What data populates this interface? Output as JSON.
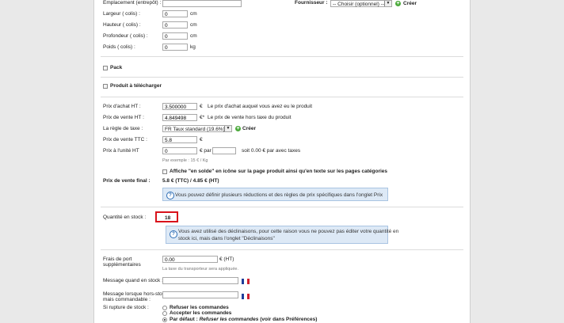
{
  "top": {
    "emplacement_label": "Emplacement (entrepôt) :",
    "largeur_label": "Largeur ( colis) :",
    "largeur_value": "0",
    "hauteur_label": "Hauteur ( colis) :",
    "hauteur_value": "0",
    "profondeur_label": "Profondeur ( colis) :",
    "profondeur_value": "0",
    "poids_label": "Poids ( colis) :",
    "poids_value": "0",
    "unit_cm": "cm",
    "unit_kg": "kg",
    "fournisseur_label": "Fournisseur :",
    "fournisseur_value": "-- Choisir (optionnel) --",
    "creer_label": "Créer"
  },
  "pack_label": "Pack",
  "telecharger_label": "Produit à télécharger",
  "price": {
    "achat_label": "Prix d'achat HT :",
    "achat_value": "3.500000",
    "achat_unit": "€",
    "achat_desc": "Le prix d'achat auquel vous avez eu le produit",
    "vente_label": "Prix de vente HT :",
    "vente_value": "4.849498",
    "vente_unit": "€*",
    "vente_desc": "Le prix de vente hors taxe du produit",
    "taxe_label": "La règle de taxe :",
    "taxe_value": "FR Taux standard (19.6%)",
    "taxe_creer": "Créer",
    "ttc_label": "Prix de vente TTC :",
    "ttc_value": "5.8",
    "ttc_unit": "€",
    "unite_label": "Prix à l'unité HT",
    "unite_value": "0",
    "unite_par": "€ par",
    "unite_soit": "soit 0.00 € par avec taxes",
    "unite_hint": "Par exemple : 15 € / Kg",
    "solde_label": "Affiche \"en solde\" en icône sur la page produit ainsi qu'en texte sur les pages catégories",
    "final_label": "Prix de vente final :",
    "final_value": "5.8 € (TTC) / 4.85 € (HT)",
    "info_text": "Vous pouvez définir plusieurs réductions et des règles de prix spécifiques dans l'onglet Prix"
  },
  "stock": {
    "quantite_label": "Quantité en stock :",
    "quantite_value": "18",
    "info_line1": "Vous avez utilisé des déclinaisons, pour cette raison vous ne pouvez pas éditer votre quantité en",
    "info_line2": "stock ici, mais dans l'onglet \"Déclinaisons\""
  },
  "shipping": {
    "frais_label_1": "Frais de port",
    "frais_label_2": "supplémentaires",
    "frais_value": "0.00",
    "frais_unit": "€ (HT)",
    "frais_hint": "La taxe du transporteur sera appliquée.",
    "msg_stock_label": "Message quand en stock :",
    "msg_hors_label_1": "Message lorsque hors-stock",
    "msg_hors_label_2": "mais commandable :",
    "rupture_label": "Si rupture de stock :",
    "opt_refuser": "Refuser les commandes",
    "opt_accepter": "Accepter les commandes",
    "opt_defaut_prefix": "Par défaut :",
    "opt_defaut_italic": "Refuser les commandes",
    "opt_defaut_suffix": "(voir dans Préférences)"
  },
  "colors": {
    "flag_blue": "#1f3d9a",
    "flag_white": "#ffffff",
    "flag_red": "#d1202f",
    "highlight_red": "#d9121b",
    "info_bg": "#dde9f6"
  }
}
